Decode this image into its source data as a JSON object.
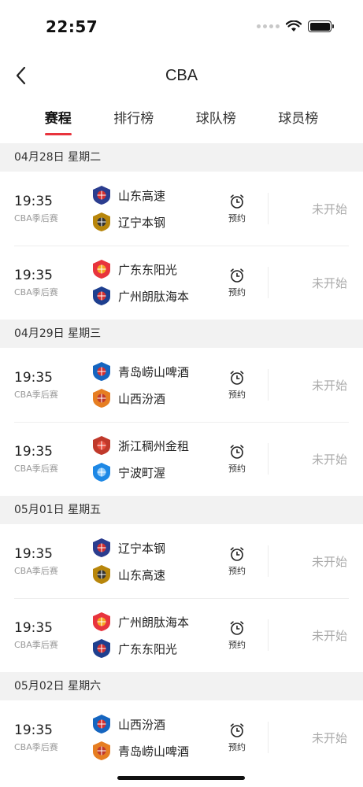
{
  "status_bar": {
    "time": "22:57"
  },
  "nav": {
    "title": "CBA"
  },
  "tabs": [
    {
      "label": "赛程",
      "active": true
    },
    {
      "label": "排行榜",
      "active": false
    },
    {
      "label": "球队榜",
      "active": false
    },
    {
      "label": "球员榜",
      "active": false
    }
  ],
  "sections": [
    {
      "date": "04月28日  星期二",
      "matches": [
        {
          "time": "19:35",
          "league": "CBA季后赛",
          "home": "山东高速",
          "away": "辽宁本钢",
          "reserve_label": "预约",
          "status": "未开始"
        },
        {
          "time": "19:35",
          "league": "CBA季后赛",
          "home": "广东东阳光",
          "away": "广州朗肽海本",
          "reserve_label": "预约",
          "status": "未开始"
        }
      ]
    },
    {
      "date": "04月29日  星期三",
      "matches": [
        {
          "time": "19:35",
          "league": "CBA季后赛",
          "home": "青岛崂山啤酒",
          "away": "山西汾酒",
          "reserve_label": "预约",
          "status": "未开始"
        },
        {
          "time": "19:35",
          "league": "CBA季后赛",
          "home": "浙江稠州金租",
          "away": "宁波町渥",
          "reserve_label": "预约",
          "status": "未开始"
        }
      ]
    },
    {
      "date": "05月01日  星期五",
      "matches": [
        {
          "time": "19:35",
          "league": "CBA季后赛",
          "home": "辽宁本钢",
          "away": "山东高速",
          "reserve_label": "预约",
          "status": "未开始"
        },
        {
          "time": "19:35",
          "league": "CBA季后赛",
          "home": "广州朗肽海本",
          "away": "广东东阳光",
          "reserve_label": "预约",
          "status": "未开始"
        }
      ]
    },
    {
      "date": "05月02日  星期六",
      "matches": [
        {
          "time": "19:35",
          "league": "CBA季后赛",
          "home": "山西汾酒",
          "away": "青岛崂山啤酒",
          "reserve_label": "预约",
          "status": "未开始"
        }
      ]
    }
  ],
  "colors": {
    "accent": "#e8343d",
    "muted": "#aaaaaa",
    "section_bg": "#f2f2f2"
  },
  "icons": {
    "back": "chevron-left-icon",
    "reserve": "alarm-clock-icon",
    "team": "team-logo-icon"
  }
}
